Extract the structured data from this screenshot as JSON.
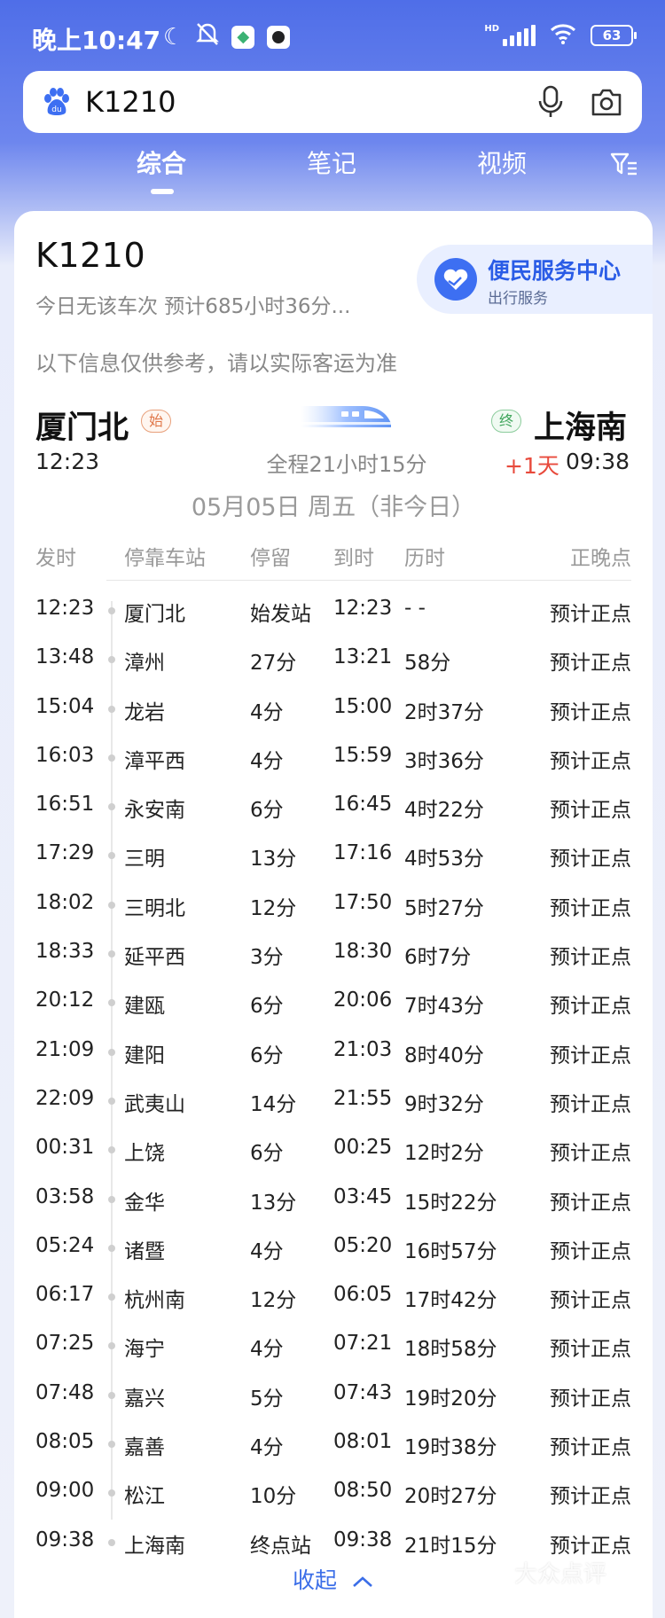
{
  "status_bar": {
    "time": "晚上10:47",
    "battery": "63",
    "network": "HD"
  },
  "search": {
    "query": "K1210"
  },
  "tabs": [
    {
      "label": "综合",
      "active": true
    },
    {
      "label": "笔记",
      "active": false
    },
    {
      "label": "视频",
      "active": false
    }
  ],
  "train": {
    "number": "K1210",
    "subtitle": "今日无该车次 预计685小时36分...",
    "notice": "以下信息仅供参考，请以实际客运为准",
    "from": {
      "station": "厦门北",
      "tag": "始",
      "time": "12:23"
    },
    "to": {
      "station": "上海南",
      "tag": "终",
      "time": "09:38",
      "day_offset": "+1天"
    },
    "duration": "全程21小时15分",
    "date": "05月05日 周五（非今日）"
  },
  "service": {
    "title": "便民服务中心",
    "subtitle": "出行服务"
  },
  "table": {
    "headers": [
      "发时",
      "停靠车站",
      "停留",
      "到时",
      "历时",
      "正晚点"
    ],
    "rows": [
      {
        "dep": "12:23",
        "station": "厦门北",
        "stop": "始发站",
        "arr": "12:23",
        "elapsed": "- -",
        "status": "预计正点"
      },
      {
        "dep": "13:48",
        "station": "漳州",
        "stop": "27分",
        "arr": "13:21",
        "elapsed": "58分",
        "status": "预计正点"
      },
      {
        "dep": "15:04",
        "station": "龙岩",
        "stop": "4分",
        "arr": "15:00",
        "elapsed": "2时37分",
        "status": "预计正点"
      },
      {
        "dep": "16:03",
        "station": "漳平西",
        "stop": "4分",
        "arr": "15:59",
        "elapsed": "3时36分",
        "status": "预计正点"
      },
      {
        "dep": "16:51",
        "station": "永安南",
        "stop": "6分",
        "arr": "16:45",
        "elapsed": "4时22分",
        "status": "预计正点"
      },
      {
        "dep": "17:29",
        "station": "三明",
        "stop": "13分",
        "arr": "17:16",
        "elapsed": "4时53分",
        "status": "预计正点"
      },
      {
        "dep": "18:02",
        "station": "三明北",
        "stop": "12分",
        "arr": "17:50",
        "elapsed": "5时27分",
        "status": "预计正点"
      },
      {
        "dep": "18:33",
        "station": "延平西",
        "stop": "3分",
        "arr": "18:30",
        "elapsed": "6时7分",
        "status": "预计正点"
      },
      {
        "dep": "20:12",
        "station": "建瓯",
        "stop": "6分",
        "arr": "20:06",
        "elapsed": "7时43分",
        "status": "预计正点"
      },
      {
        "dep": "21:09",
        "station": "建阳",
        "stop": "6分",
        "arr": "21:03",
        "elapsed": "8时40分",
        "status": "预计正点"
      },
      {
        "dep": "22:09",
        "station": "武夷山",
        "stop": "14分",
        "arr": "21:55",
        "elapsed": "9时32分",
        "status": "预计正点"
      },
      {
        "dep": "00:31",
        "station": "上饶",
        "stop": "6分",
        "arr": "00:25",
        "elapsed": "12时2分",
        "status": "预计正点"
      },
      {
        "dep": "03:58",
        "station": "金华",
        "stop": "13分",
        "arr": "03:45",
        "elapsed": "15时22分",
        "status": "预计正点"
      },
      {
        "dep": "05:24",
        "station": "诸暨",
        "stop": "4分",
        "arr": "05:20",
        "elapsed": "16时57分",
        "status": "预计正点"
      },
      {
        "dep": "06:17",
        "station": "杭州南",
        "stop": "12分",
        "arr": "06:05",
        "elapsed": "17时42分",
        "status": "预计正点"
      },
      {
        "dep": "07:25",
        "station": "海宁",
        "stop": "4分",
        "arr": "07:21",
        "elapsed": "18时58分",
        "status": "预计正点"
      },
      {
        "dep": "07:48",
        "station": "嘉兴",
        "stop": "5分",
        "arr": "07:43",
        "elapsed": "19时20分",
        "status": "预计正点"
      },
      {
        "dep": "08:05",
        "station": "嘉善",
        "stop": "4分",
        "arr": "08:01",
        "elapsed": "19时38分",
        "status": "预计正点"
      },
      {
        "dep": "09:00",
        "station": "松江",
        "stop": "10分",
        "arr": "08:50",
        "elapsed": "20时27分",
        "status": "预计正点"
      },
      {
        "dep": "09:38",
        "station": "上海南",
        "stop": "终点站",
        "arr": "09:38",
        "elapsed": "21时15分",
        "status": "预计正点"
      }
    ]
  },
  "collapse_label": "收起",
  "watermark": "大众点评",
  "colors": {
    "accent": "#3b6ee8",
    "late_day": "#e84a3c"
  }
}
